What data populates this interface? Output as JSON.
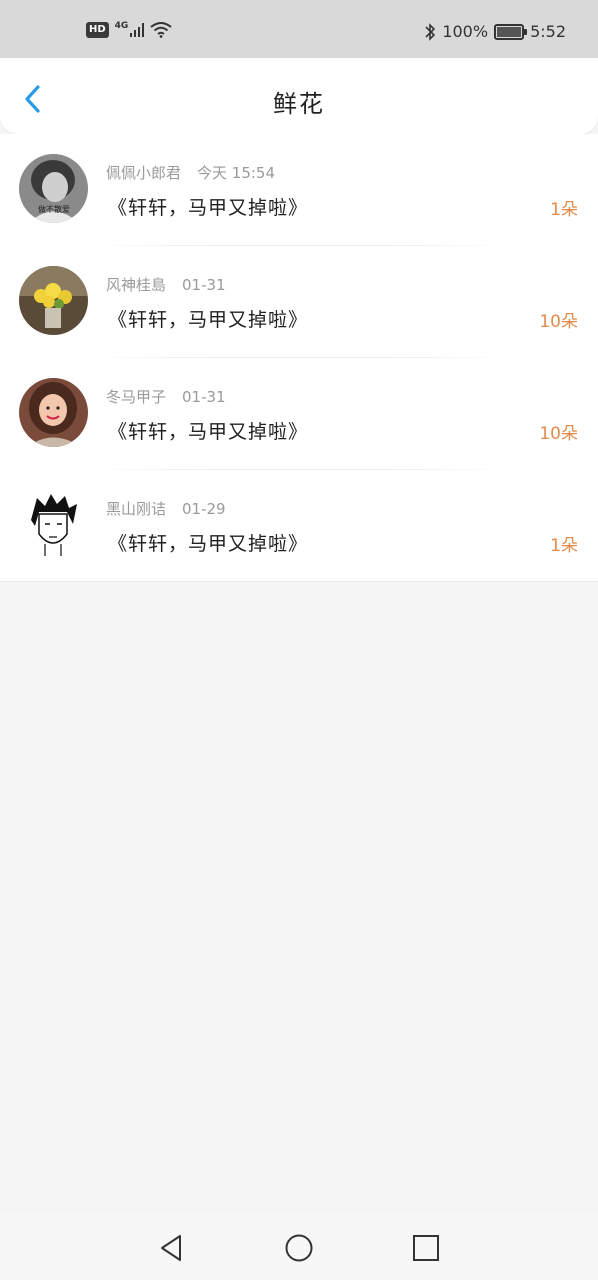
{
  "status_bar": {
    "hd": "HD",
    "network": "4G",
    "battery_percent": "100%",
    "time": "5:52"
  },
  "header": {
    "title": "鲜花"
  },
  "items": [
    {
      "name": "佩佩小郎君",
      "time": "今天 15:54",
      "message": "《轩轩，马甲又掉啦》",
      "count": "1朵",
      "avatar_text": "做不散爱"
    },
    {
      "name": "风神桂島",
      "time": "01-31",
      "message": "《轩轩，马甲又掉啦》",
      "count": "10朵"
    },
    {
      "name": "冬马甲子",
      "time": "01-31",
      "message": "《轩轩，马甲又掉啦》",
      "count": "10朵"
    },
    {
      "name": "黑山刚诘",
      "time": "01-29",
      "message": "《轩轩，马甲又掉啦》",
      "count": "1朵"
    }
  ],
  "colors": {
    "accent": "#2a9be8",
    "count": "#e48a4a",
    "background": "#f6f5f6"
  }
}
